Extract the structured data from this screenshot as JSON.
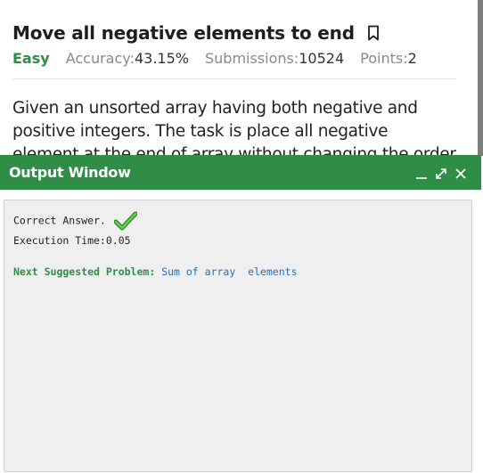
{
  "problem": {
    "title": "Move all negative elements to end",
    "difficulty": "Easy",
    "accuracy_label": "Accuracy:",
    "accuracy_value": "43.15%",
    "submissions_label": "Submissions:",
    "submissions_value": "10524",
    "points_label": "Points:",
    "points_value": "2",
    "description": "Given an unsorted array having both negative and positive integers. The task is place all negative element at the end of array without changing the order of positive"
  },
  "output_window": {
    "title": "Output Window",
    "controls": [
      "minimize-icon",
      "expand-icon",
      "close-icon"
    ],
    "result_text": "Correct Answer.",
    "execution_time": "Execution Time:0.05",
    "next_suggested_label": "Next Suggested Problem:",
    "next_suggested_link": "Sum of array  elements"
  },
  "colors": {
    "accent_green": "#2f8d46",
    "link_blue": "#2b6db5",
    "output_bg": "#efefef"
  }
}
